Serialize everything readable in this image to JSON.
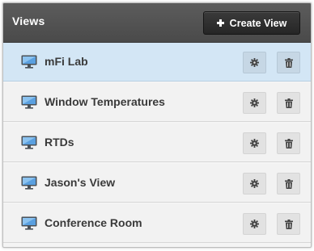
{
  "header": {
    "title": "Views",
    "create_label": "Create View"
  },
  "views": [
    {
      "label": "mFi Lab",
      "selected": true
    },
    {
      "label": "Window Temperatures",
      "selected": false
    },
    {
      "label": "RTDs",
      "selected": false
    },
    {
      "label": "Jason's View",
      "selected": false
    },
    {
      "label": "Conference Room",
      "selected": false
    }
  ],
  "colors": {
    "header_bg": "#4f4f4f",
    "selected_row": "#d3e6f5",
    "row_bg": "#f2f2f2",
    "monitor_screen": "#4a90d9"
  },
  "icons": [
    "plus-icon",
    "monitor-icon",
    "gear-icon",
    "trash-icon"
  ]
}
